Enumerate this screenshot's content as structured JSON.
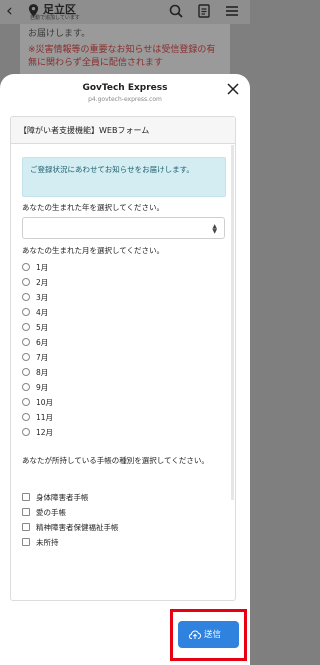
{
  "app": {
    "title": "足立区",
    "subtitle": "自動で追加しています",
    "bg_text": "お届けします。",
    "bg_notice": "※災害情報等の重要なお知らせは受信登録の有無に関わらず全員に配信されます"
  },
  "sheet": {
    "title": "GovTech Express",
    "url": "p4.govtech-express.com"
  },
  "form": {
    "header": "【障がい者支援機能】WEBフォーム",
    "info": "ご登録状況にあわせてお知らせをお届けします。",
    "q_year": "あなたの生まれた年を選択してください。",
    "q_month": "あなたの生まれた月を選択してください。",
    "months": [
      "1月",
      "2月",
      "3月",
      "4月",
      "5月",
      "6月",
      "7月",
      "8月",
      "9月",
      "10月",
      "11月",
      "12月"
    ],
    "q_card": "あなたが所持している手帳の種別を選択してください。",
    "cards": [
      "身体障害者手帳",
      "愛の手帳",
      "精神障害者保健福祉手帳",
      "未所持"
    ]
  },
  "submit": {
    "label": "送信"
  },
  "colors": {
    "accent": "#2f82de",
    "highlight": "#e60012",
    "info_bg": "#d4edf3"
  }
}
